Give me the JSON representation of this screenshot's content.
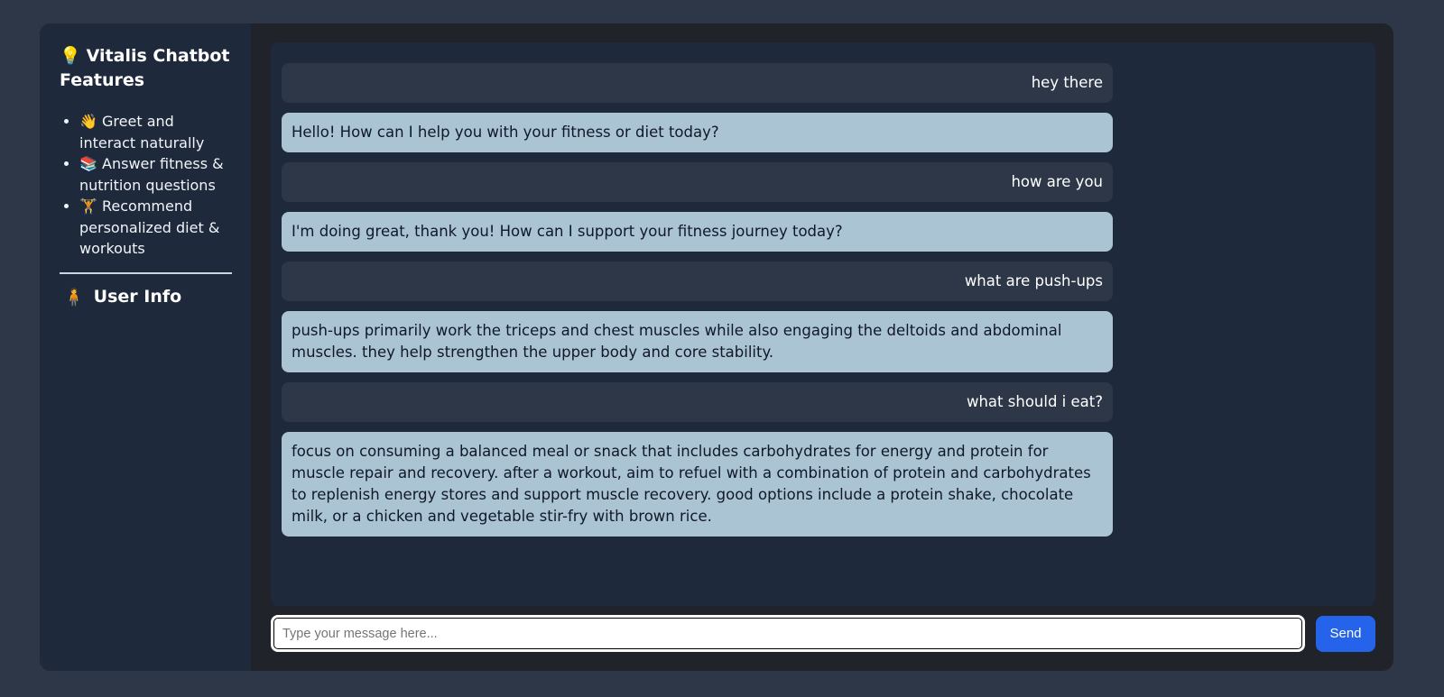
{
  "sidebar": {
    "title_icon": "💡",
    "title": "Vitalis Chatbot Features",
    "features": [
      {
        "icon": "👋",
        "text": "Greet and interact naturally"
      },
      {
        "icon": "📚",
        "text": "Answer fitness & nutrition questions"
      },
      {
        "icon": "🏋️",
        "text": "Recommend personalized diet & workouts"
      }
    ],
    "user_info_icon": "🧍",
    "user_info": "User Info"
  },
  "chat": {
    "messages": [
      {
        "role": "user",
        "text": "hey there"
      },
      {
        "role": "bot",
        "text": "Hello! How can I help you with your fitness or diet today?"
      },
      {
        "role": "user",
        "text": "how are you"
      },
      {
        "role": "bot",
        "text": "I'm doing great, thank you! How can I support your fitness journey today?"
      },
      {
        "role": "user",
        "text": "what are push-ups"
      },
      {
        "role": "bot",
        "text": "push-ups primarily work the triceps and chest muscles while also engaging the deltoids and abdominal muscles. they help strengthen the upper body and core stability."
      },
      {
        "role": "user",
        "text": "what should i eat?"
      },
      {
        "role": "bot",
        "text": "focus on consuming a balanced meal or snack that includes carbohydrates for energy and protein for muscle repair and recovery. after a workout, aim to refuel with a combination of protein and carbohydrates to replenish energy stores and support muscle recovery. good options include a protein shake, chocolate milk, or a chicken and vegetable stir-fry with brown rice."
      }
    ]
  },
  "composer": {
    "placeholder": "Type your message here...",
    "value": "",
    "send_label": "Send"
  },
  "colors": {
    "background": "#2d3748",
    "sidebar": "#1e293b",
    "user_bubble": "#2d3748",
    "bot_bubble": "#aac4d4",
    "send_button": "#2563eb"
  }
}
